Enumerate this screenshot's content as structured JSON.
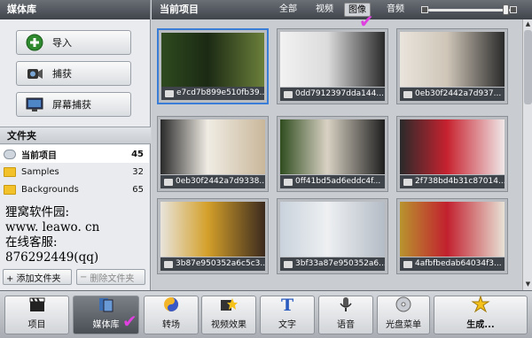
{
  "left": {
    "title": "媒体库",
    "buttons": [
      {
        "label": "导入",
        "icon": "plus-circle-icon"
      },
      {
        "label": "捕获",
        "icon": "camera-icon"
      },
      {
        "label": "屏幕捕获",
        "icon": "monitor-icon"
      }
    ],
    "folder_title": "文件夹",
    "folders": [
      {
        "name": "当前项目",
        "count": "45",
        "selected": true
      },
      {
        "name": "Samples",
        "count": "32",
        "selected": false
      },
      {
        "name": "Backgrounds",
        "count": "65",
        "selected": false
      }
    ],
    "overlay_lines": [
      "狸窝软件园:",
      "www. leawo. cn",
      "在线客服:",
      "876292449(qq)"
    ],
    "add_folder": "+ 添加文件夹",
    "delete_folder": "删除文件夹"
  },
  "right": {
    "title": "当前项目",
    "filters": [
      "全部",
      "视频",
      "图像",
      "音频"
    ],
    "active_filter": "图像"
  },
  "thumbnails": [
    {
      "caption": "e7cd7b899e510fb39...",
      "colors": [
        "#2e4a1e",
        "#1b2a14",
        "#6b7f3a"
      ],
      "selected": true
    },
    {
      "caption": "0dd7912397dda144...",
      "colors": [
        "#f2f2f2",
        "#dcdcdc",
        "#2a2a2a"
      ],
      "selected": false
    },
    {
      "caption": "0eb30f2442a7d937...",
      "colors": [
        "#e9e4dc",
        "#cfc6b8",
        "#2a2a2a"
      ],
      "selected": false
    },
    {
      "caption": "0eb30f2442a7d9338...",
      "colors": [
        "#2a2a2a",
        "#f0ece4",
        "#c9b79a"
      ],
      "selected": false
    },
    {
      "caption": "0ff41bd5ad6eddc4f...",
      "colors": [
        "#2f4d1f",
        "#d9d2c4",
        "#1e1e1e"
      ],
      "selected": false
    },
    {
      "caption": "2f738bd4b31c87014...",
      "colors": [
        "#2a2a2a",
        "#c7222f",
        "#f0e8e8"
      ],
      "selected": false
    },
    {
      "caption": "3b87e950352a6c5c3...",
      "colors": [
        "#e8e4dc",
        "#d4a02a",
        "#3b2a1e"
      ],
      "selected": false
    },
    {
      "caption": "3bf33a87e950352a6...",
      "colors": [
        "#c9d2dc",
        "#eef0f2",
        "#b4bcc6"
      ],
      "selected": false
    },
    {
      "caption": "4afbfbedab64034f3...",
      "colors": [
        "#b8942e",
        "#c2202e",
        "#e8e2d6"
      ],
      "selected": false
    }
  ],
  "toolbar": [
    {
      "label": "项目",
      "icon": "clapper-icon",
      "active": false
    },
    {
      "label": "媒体库",
      "icon": "media-library-icon",
      "active": true
    },
    {
      "label": "转场",
      "icon": "transition-icon",
      "active": false
    },
    {
      "label": "视频效果",
      "icon": "effects-icon",
      "active": false
    },
    {
      "label": "文字",
      "icon": "text-icon",
      "active": false
    },
    {
      "label": "语音",
      "icon": "microphone-icon",
      "active": false
    },
    {
      "label": "光盘菜单",
      "icon": "disc-menu-icon",
      "active": false
    },
    {
      "label": "生成...",
      "icon": "generate-icon",
      "active": false
    }
  ]
}
